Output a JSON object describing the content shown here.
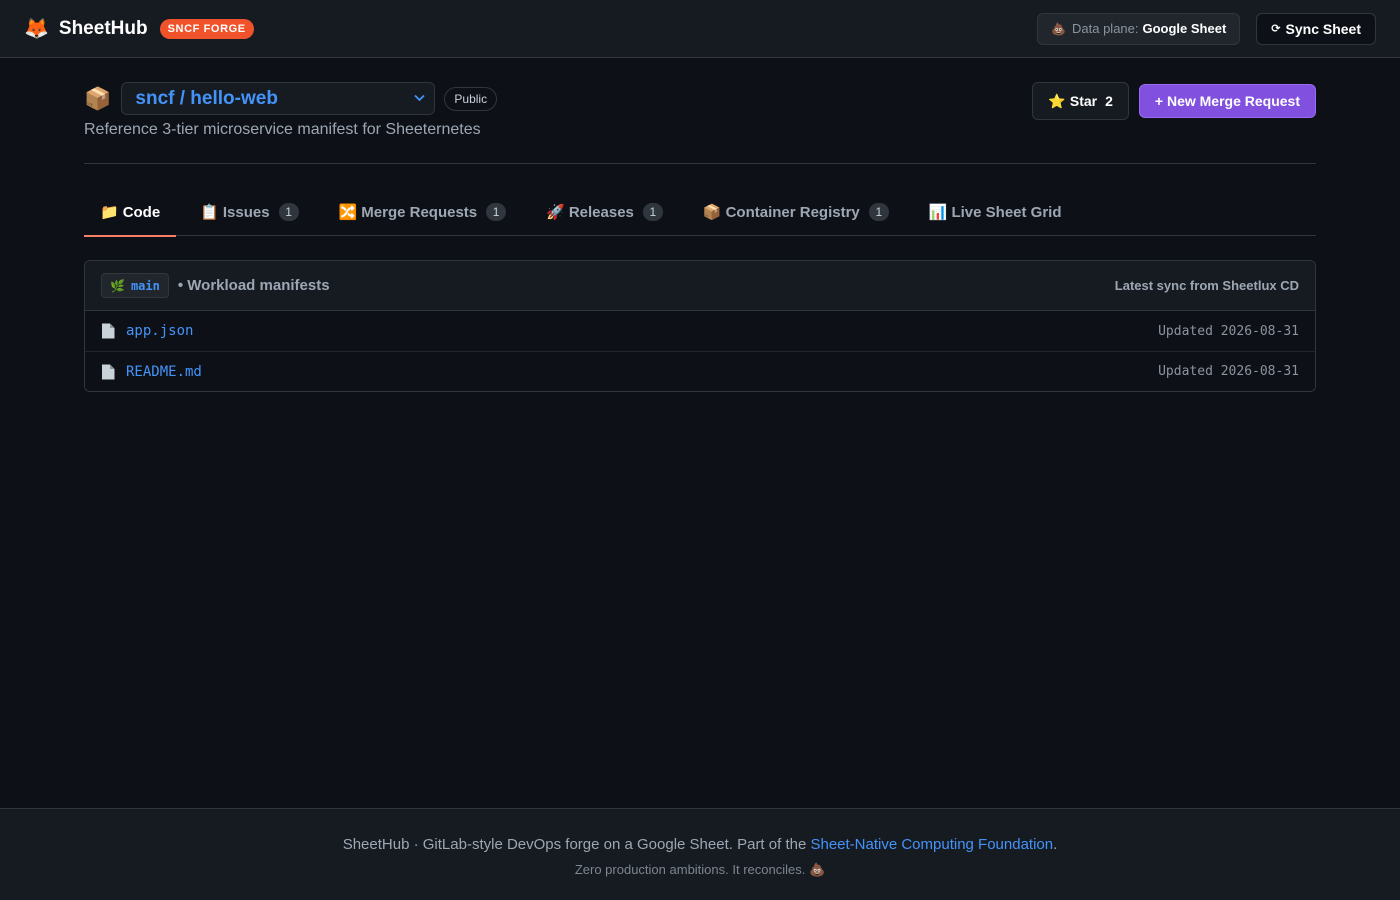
{
  "topbar": {
    "logo_icon": "🦊",
    "brand": "SheetHub",
    "badge": "SNCF FORGE",
    "dataplane_icon": "💩",
    "dataplane_label": "Data plane:",
    "dataplane_value": "Google Sheet",
    "sync_icon": "⟳",
    "sync_label": "Sync Sheet"
  },
  "repo": {
    "icon": "📦",
    "name": "sncf / hello-web",
    "visibility": "Public",
    "description": "Reference 3-tier microservice manifest for Sheeternetes",
    "star_icon": "⭐",
    "star_label": "Star",
    "star_count": "2",
    "new_mr_label": "+ New Merge Request"
  },
  "tabs": [
    {
      "icon": "📁",
      "label": "Code",
      "count": null,
      "active": true
    },
    {
      "icon": "📋",
      "label": "Issues",
      "count": "1"
    },
    {
      "icon": "🔀",
      "label": "Merge Requests",
      "count": "1"
    },
    {
      "icon": "🚀",
      "label": "Releases",
      "count": "1"
    },
    {
      "icon": "📦",
      "label": "Container Registry",
      "count": "1"
    },
    {
      "icon": "📊",
      "label": "Live Sheet Grid",
      "count": null
    }
  ],
  "panel": {
    "branch_icon": "🌿",
    "branch": "main",
    "title": "• Workload manifests",
    "sync_text": "Latest sync from Sheetlux CD",
    "files": [
      {
        "name": "app.json",
        "updated": "Updated 2026-08-31"
      },
      {
        "name": "README.md",
        "updated": "Updated 2026-08-31"
      }
    ]
  },
  "footer": {
    "line1_prefix": "SheetHub · GitLab-style DevOps forge on a Google Sheet. Part of the ",
    "line1_link": "Sheet-Native Computing Foundation",
    "line1_suffix": ".",
    "line2": "Zero production ambitions. It reconciles. 💩"
  },
  "colors": {
    "background": "#0d1117",
    "surface": "#161b22",
    "accent_link": "#4493f8",
    "primary_button": "#8250df",
    "badge": "#f0532b",
    "active_tab_underline": "#f78166"
  }
}
